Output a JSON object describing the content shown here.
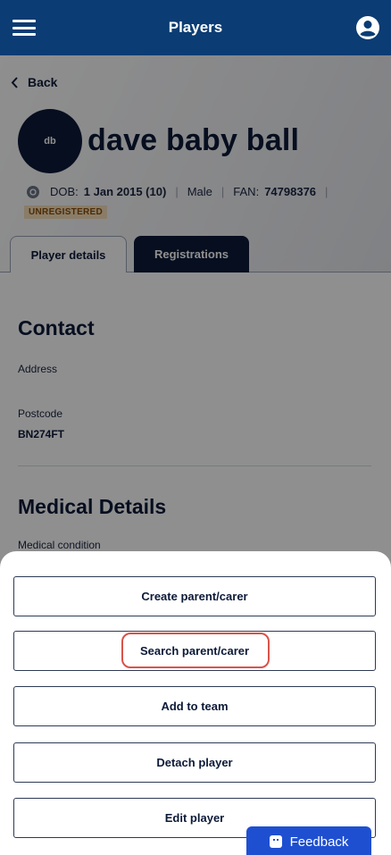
{
  "header": {
    "title": "Players"
  },
  "nav": {
    "back_label": "Back"
  },
  "player": {
    "initials": "db",
    "name": "dave baby ball",
    "dob_label": "DOB:",
    "dob_value": "1 Jan 2015 (10)",
    "gender": "Male",
    "fan_label": "FAN:",
    "fan_value": "74798376",
    "status": "UNREGISTERED"
  },
  "tabs": [
    {
      "label": "Player details"
    },
    {
      "label": "Registrations"
    }
  ],
  "contact": {
    "title": "Contact",
    "address_label": "Address",
    "postcode_label": "Postcode",
    "postcode_value": "BN274FT"
  },
  "medical": {
    "title": "Medical Details",
    "condition_label": "Medical condition"
  },
  "actions": [
    {
      "label": "Create parent/carer"
    },
    {
      "label": "Search parent/carer"
    },
    {
      "label": "Add to team"
    },
    {
      "label": "Detach player"
    },
    {
      "label": "Edit player"
    }
  ],
  "feedback": {
    "label": "Feedback"
  },
  "colors": {
    "topbar": "#0b3c73",
    "navy": "#0c1a38",
    "badge_bg": "#f7dfba",
    "highlight": "#d9534a",
    "feedback_bg": "#1f4fd1"
  }
}
